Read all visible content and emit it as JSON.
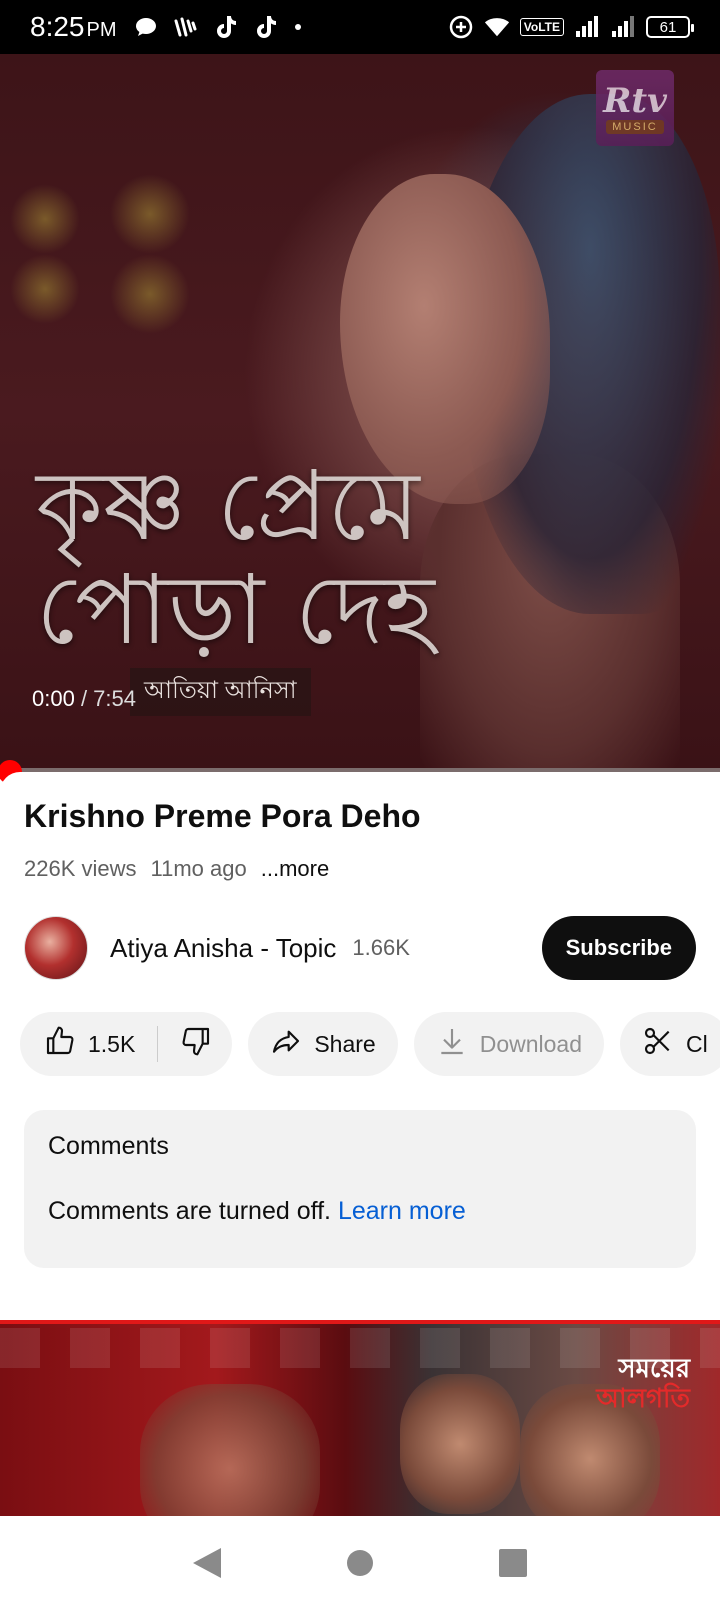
{
  "status_bar": {
    "time": "8:25",
    "ampm": "PM",
    "volte": "VoLTE",
    "battery": "61"
  },
  "video": {
    "overlay_line1": "কৃষ্ণ প্রেমে",
    "overlay_line2": "পোড়া দেহ",
    "overlay_artist": "আতিয়া আনিসা",
    "logo_text": "Rtv",
    "logo_sub": "MUSIC",
    "current_time": "0:00",
    "separator": " / ",
    "duration": "7:54",
    "progress": 0.0
  },
  "info": {
    "title": "Krishno Preme Pora Deho",
    "views": "226K views",
    "age": "11mo ago",
    "more": "...more"
  },
  "channel": {
    "name": "Atiya Anisha - Topic",
    "subscribers": "1.66K",
    "subscribe_label": "Subscribe"
  },
  "actions": {
    "likes": "1.5K",
    "share": "Share",
    "download": "Download",
    "clip": "Cl"
  },
  "comments": {
    "title": "Comments",
    "message": "Comments are turned off.",
    "link": "Learn more"
  },
  "next_video": {
    "brand_line1": "সময়ের",
    "brand_line2": "আলগতি"
  },
  "colors": {
    "accent": "#ff0000",
    "link": "#065fd4",
    "subscribe_bg": "#0f0f0f"
  },
  "icons": [
    "comment-icon",
    "wifi-icon",
    "tiktok-icon",
    "tiktok-icon",
    "data-saver-icon",
    "wifi-signal-icon",
    "signal-icon",
    "battery-icon",
    "like-icon",
    "dislike-icon",
    "share-icon",
    "download-icon",
    "scissors-icon",
    "back-icon",
    "home-icon",
    "recents-icon"
  ]
}
